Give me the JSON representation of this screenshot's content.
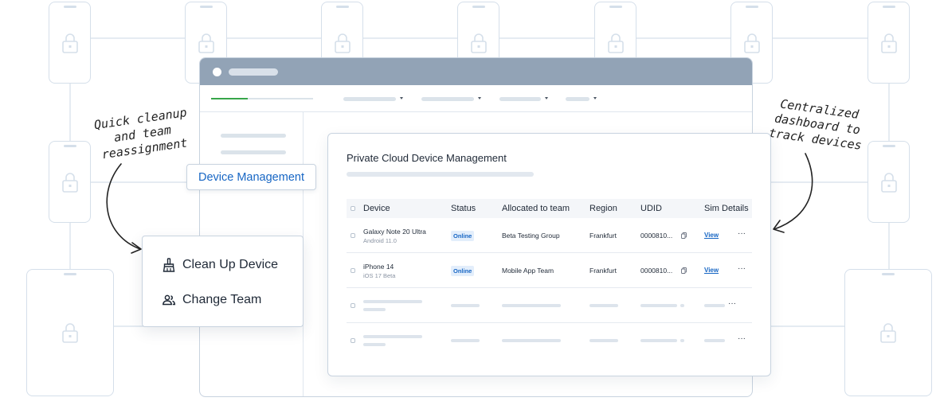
{
  "annotations": {
    "left": "Quick cleanup\nand team\nreassignment",
    "right": "Centralized\ndashboard to\ntrack devices"
  },
  "sidebar_tag": "Device Management",
  "browser": {
    "nav_progress": 0.36
  },
  "context_menu": {
    "items": [
      {
        "label": "Clean Up Device",
        "icon": "broom-icon"
      },
      {
        "label": "Change Team",
        "icon": "team-icon"
      }
    ]
  },
  "dashboard": {
    "title": "Private Cloud Device Management",
    "columns": [
      "Device",
      "Status",
      "Allocated to team",
      "Region",
      "UDID",
      "Sim Details"
    ],
    "rows": [
      {
        "device": "Galaxy Note 20 Ultra",
        "os": "Android 11.0",
        "status": "Online",
        "team": "Beta Testing Group",
        "region": "Frankfurt",
        "udid": "0000810...",
        "sim": "View"
      },
      {
        "device": "iPhone 14",
        "os": "iOS 17 Beta",
        "status": "Online",
        "team": "Mobile App Team",
        "region": "Frankfurt",
        "udid": "0000810...",
        "sim": "View"
      }
    ],
    "more_icon": "ellipsis-icon",
    "copy_icon": "copy-icon"
  },
  "colors": {
    "accent": "#1766c4",
    "titlebar": "#92a3b6",
    "progress": "#37a64a",
    "badge_bg": "#e3eefb"
  }
}
